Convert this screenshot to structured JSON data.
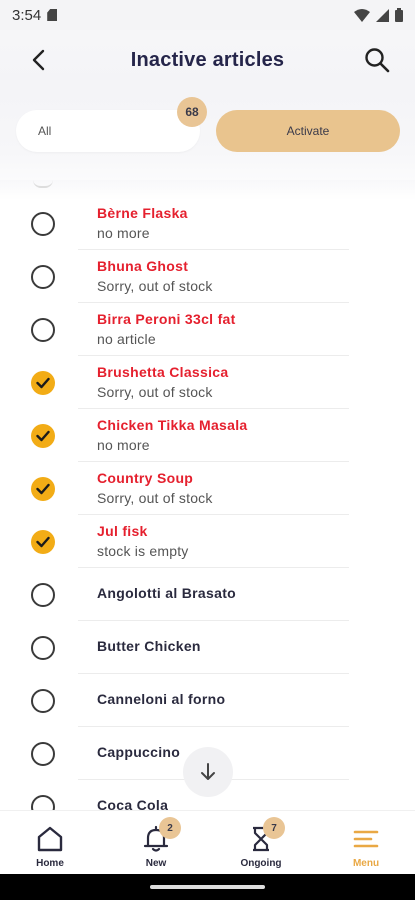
{
  "status_bar": {
    "time": "3:54"
  },
  "header": {
    "title": "Inactive articles"
  },
  "filter": {
    "all_label": "All",
    "count": "68",
    "activate_label": "Activate"
  },
  "items": [
    {
      "name": "Bèrne Flaska",
      "reason": "no more",
      "checked": false,
      "red": true
    },
    {
      "name": "Bhuna Ghost",
      "reason": "Sorry, out of stock",
      "checked": false,
      "red": true
    },
    {
      "name": "Birra Peroni 33cl fat",
      "reason": "no article",
      "checked": false,
      "red": true
    },
    {
      "name": "Brushetta Classica",
      "reason": "Sorry, out of stock",
      "checked": true,
      "red": true
    },
    {
      "name": "Chicken Tikka Masala",
      "reason": "no more",
      "checked": true,
      "red": true
    },
    {
      "name": "Country Soup",
      "reason": "Sorry, out of stock",
      "checked": true,
      "red": true
    },
    {
      "name": "Jul fisk",
      "reason": "stock is empty",
      "checked": true,
      "red": true
    },
    {
      "name": "Angolotti al Brasato",
      "reason": "",
      "checked": false,
      "red": false
    },
    {
      "name": "Butter Chicken",
      "reason": "",
      "checked": false,
      "red": false
    },
    {
      "name": "Canneloni al forno",
      "reason": "",
      "checked": false,
      "red": false
    },
    {
      "name": "Cappuccino",
      "reason": "",
      "checked": false,
      "red": false
    },
    {
      "name": "Coca Cola",
      "reason": "",
      "checked": false,
      "red": false
    }
  ],
  "nav": {
    "home": "Home",
    "new": "New",
    "new_badge": "2",
    "ongoing": "Ongoing",
    "ongoing_badge": "7",
    "menu": "Menu"
  },
  "colors": {
    "accent": "#e9c48e",
    "check": "#f2ac16",
    "inactive_name": "#e5202e",
    "active_tab": "#e9a844"
  }
}
